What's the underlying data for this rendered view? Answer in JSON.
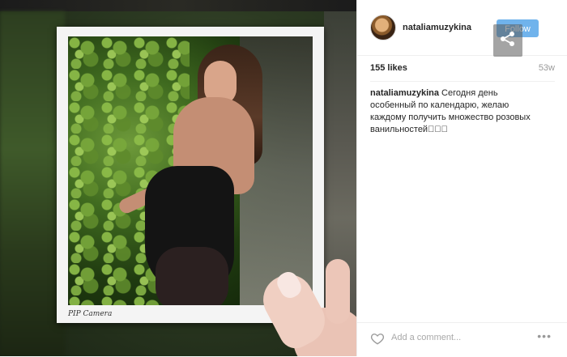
{
  "photo": {
    "caption_label": "PIP Camera"
  },
  "post": {
    "username": "nataliamuzykina",
    "follow_label": "Follow",
    "likes": "155 likes",
    "time_ago": "53w",
    "comment_author": "nataliamuzykina",
    "comment_text": "Сегодня день особенный по календарю, желаю каждому получить множество розовых ванильностей🏼🏼🏼",
    "add_comment_placeholder": "Add a comment...",
    "more_label": "•••"
  },
  "icons": {
    "share": "share-icon",
    "heart": "heart-icon",
    "more": "more-icon"
  },
  "colors": {
    "follow_bg": "#70b3ec",
    "text": "#262626",
    "muted": "#999999"
  }
}
